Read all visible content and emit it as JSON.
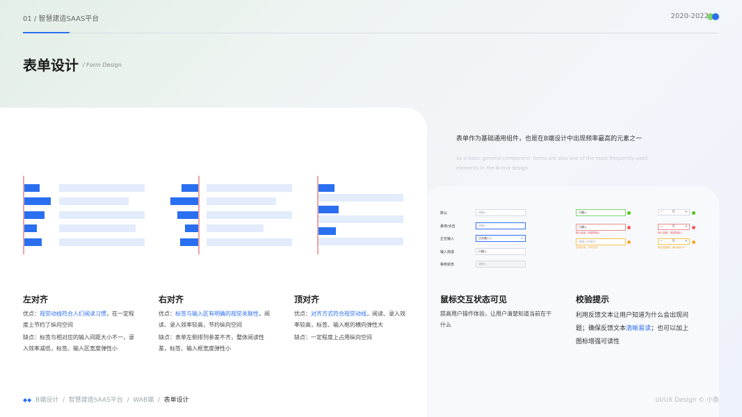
{
  "header": {
    "left_label": "01 / 智慧建造SAAS平台",
    "right_label": "2020-2022"
  },
  "page": {
    "title": "表单设计",
    "subtitle": "/ Form Design"
  },
  "intro": {
    "text": "表单作为基础通用组件，也是在B端设计中出现频率最高的元素之一",
    "text_en": "As a basic general component, forms are also one of the most frequently used elements in the B-end design"
  },
  "colors": {
    "accent": "#2a6ff0",
    "guide": "#f0a2a2",
    "bar": "#e2ecfc",
    "dot_green": "#7ed36b",
    "dot_blue": "#2a6ff0"
  },
  "sections": [
    {
      "title": "左对齐",
      "pros_prefix": "优点：",
      "pros_hl": "视觉动线符合人们阅读习惯",
      "pros_rest": "，在一定程度上节约了纵向空间",
      "cons": "缺点：标签与相对应的输入间距大小不一，录入效率减低，标签、输入区宽度弹性小"
    },
    {
      "title": "右对齐",
      "pros_prefix": "优点：",
      "pros_hl": "标签与输入区有明确的视觉关联性",
      "pros_rest": "，阅读、录入效率较高，节约纵向空间",
      "cons": "缺点：表单左侧排列参差不齐，整体阅读性差，标签、输入框宽度弹性小"
    },
    {
      "title": "顶对齐",
      "pros_prefix": "优点：",
      "pros_hl": "对齐方式符合视觉动线",
      "pros_rest": "，阅读、录入效率较高，标签、输入框的横向弹性大",
      "cons": "缺点：一定程度上占用纵向空间"
    },
    {
      "title": "鼠标交互状态可见",
      "text": "提高用户操作体验，让用户清楚知道当前在干什么"
    },
    {
      "title": "校验提示",
      "text_a": "利用反馈文本让用户知道为什么会出现问题；确保反馈文本",
      "text_hl": "清晰易读",
      "text_b": "；也可以加上图标增强可读性"
    }
  ],
  "form_states": {
    "labels": [
      "默认",
      "悬停/点击",
      "正在输入",
      "输入完成",
      "禁用状态"
    ],
    "inputs": [
      "请输入",
      "请输入",
      "正在输入 |",
      "已输入",
      "请输入"
    ],
    "validate_inputs": [
      "已输入",
      "已输入",
      "请输入关键词"
    ],
    "validate_msgs": [
      "",
      "输入错误，请重新输入",
      "此项必填，不可为空"
    ],
    "stepper_value": "0",
    "stepper_msgs": [
      "",
      "输入错误，请重新输入",
      "超出范围值，最大值为10"
    ]
  },
  "footer": {
    "crumb": [
      "B端设计",
      "智慧建造SAAS平台",
      "WAB端",
      "表单设计"
    ],
    "right": "UI/UX Design © 小鱼"
  }
}
